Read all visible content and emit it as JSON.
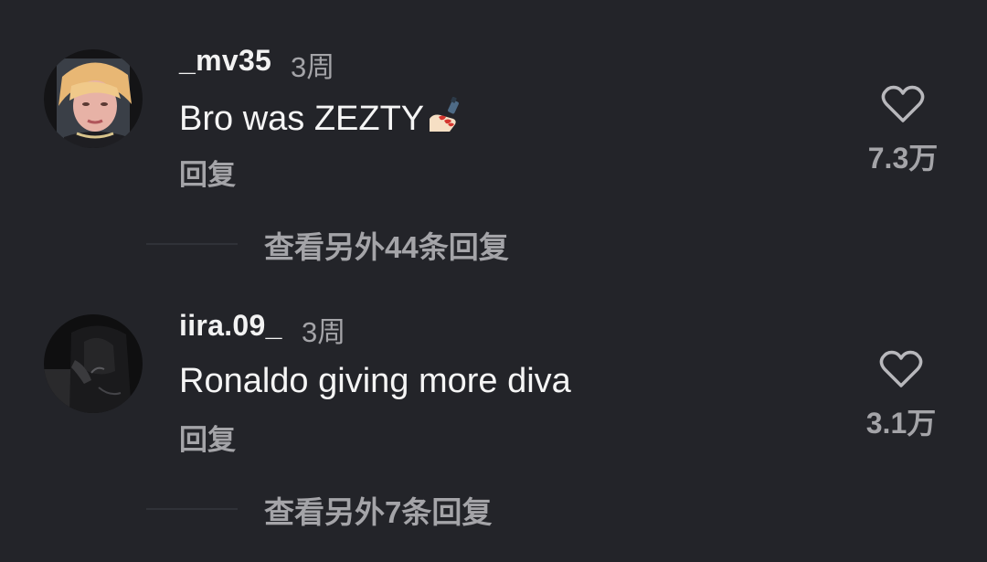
{
  "comments": [
    {
      "username": "_mv35",
      "time": "3周",
      "text": "Bro was ZEZTY",
      "emoji": "nail-polish-icon",
      "reply_label": "回复",
      "like_count": "7.3万",
      "more_replies": "查看另外44条回复"
    },
    {
      "username": "iira.09_",
      "time": "3周",
      "text": "Ronaldo giving more diva",
      "reply_label": "回复",
      "like_count": "3.1万",
      "more_replies": "查看另外7条回复"
    }
  ],
  "colors": {
    "background": "#232429",
    "primary_text": "#f5f5f5",
    "secondary_text": "#a4a4a8"
  }
}
